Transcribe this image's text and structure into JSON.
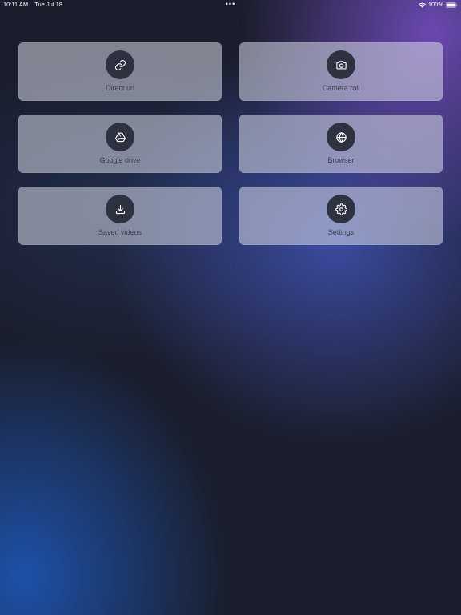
{
  "status_bar": {
    "time": "10:11 AM",
    "date": "Tue Jul 18",
    "dots": "•••",
    "battery": "100%"
  },
  "tiles": [
    {
      "label": "Direct url",
      "icon": "link-icon"
    },
    {
      "label": "Camera roll",
      "icon": "camera-icon"
    },
    {
      "label": "Google drive",
      "icon": "google-drive-icon"
    },
    {
      "label": "Browser",
      "icon": "globe-icon"
    },
    {
      "label": "Saved videos",
      "icon": "download-icon"
    },
    {
      "label": "Settings",
      "icon": "gear-icon"
    }
  ],
  "colors": {
    "background": "#1a1d2b",
    "tile_icon_circle": "#2d3140",
    "label_text": "#3b3f4d"
  }
}
